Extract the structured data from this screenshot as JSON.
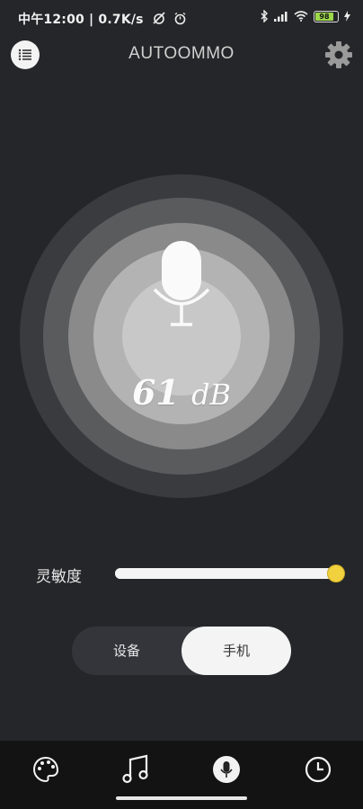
{
  "status_bar": {
    "time_info": "中午12:00 | 0.7K/s",
    "battery": "98"
  },
  "header": {
    "title": "AUTOOMMO"
  },
  "meter": {
    "value": "61",
    "unit": "dB"
  },
  "sensitivity": {
    "label": "灵敏度",
    "level_percent": 100
  },
  "source_toggle": {
    "options": [
      "设备",
      "手机"
    ],
    "selected": "手机"
  },
  "bottom_nav": {
    "items": [
      "palette-icon",
      "music-note-icon",
      "microphone-icon",
      "clock-icon"
    ],
    "active": "microphone-icon"
  },
  "colors": {
    "background": "#252629",
    "accent": "#f1d13e",
    "nav_background": "#131314"
  }
}
